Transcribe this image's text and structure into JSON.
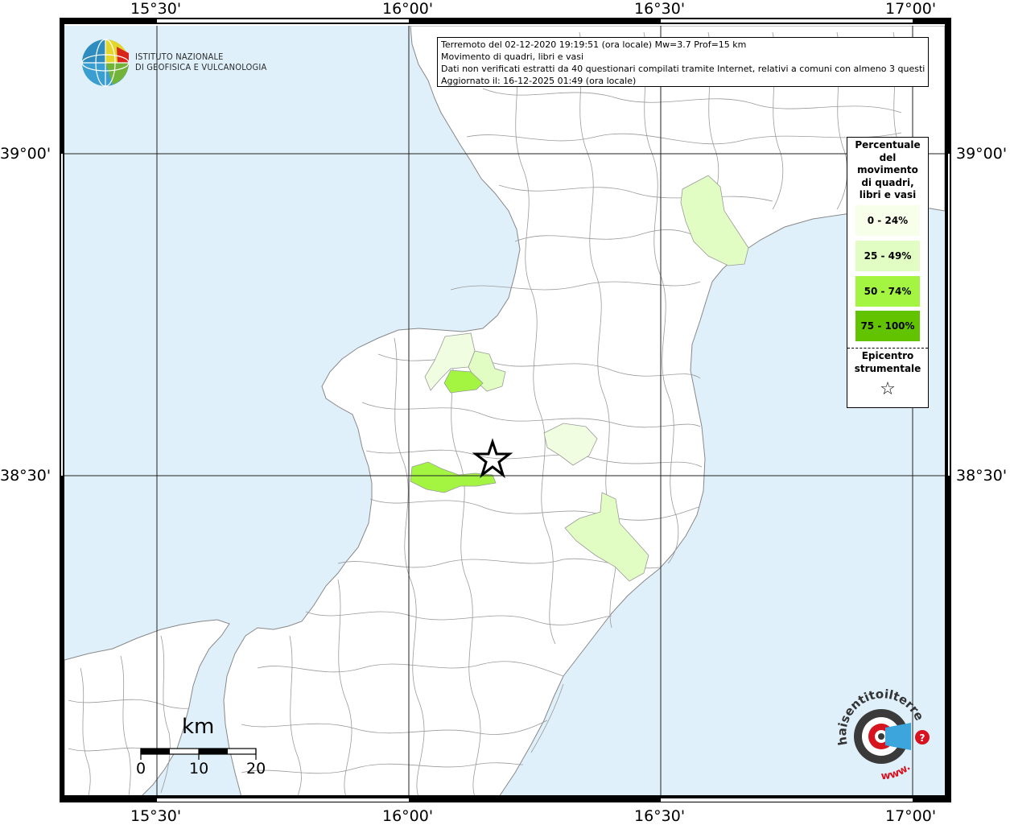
{
  "map": {
    "ticks": {
      "lon": [
        "15°30'",
        "16°00'",
        "16°30'",
        "17°00'"
      ],
      "lat": [
        "39°00'",
        "38°30'"
      ]
    },
    "colors": {
      "sea": "#dff0fb",
      "land": "#ffffff",
      "c0_24": "#f7ffeb",
      "c25_49": "#e2fdc4",
      "c50_74": "#a3f542",
      "c75_100": "#62c400"
    }
  },
  "info": {
    "line1": "Terremoto del 02-12-2020 19:19:51 (ora locale) Mw=3.7 Prof=15 km",
    "line2": "Movimento di quadri, libri e vasi",
    "line3": "Dati non verificati estratti da 40 questionari compilati tramite Internet, relativi a comuni con almeno 3 questionari.",
    "line4": "Aggiornato il: 16-12-2025 01:49 (ora locale)"
  },
  "legend": {
    "title_lines": [
      "Percentuale",
      "del",
      "movimento",
      "di quadri,",
      "libri e vasi"
    ],
    "classes": [
      "0 - 24%",
      "25 - 49%",
      "50 - 74%",
      "75 - 100%"
    ],
    "epicenter_lines": [
      "Epicentro",
      "strumentale"
    ],
    "epicenter_symbol": "☆"
  },
  "logo": {
    "line1": "ISTITUTO NAZIONALE",
    "line2": "DI GEOFISICA E VULCANOLOGIA"
  },
  "badge": {
    "text": "haisentitoilterremoto.it",
    "www": "www."
  },
  "scale": {
    "unit": "km",
    "labels": [
      "0",
      "10",
      "20"
    ]
  }
}
